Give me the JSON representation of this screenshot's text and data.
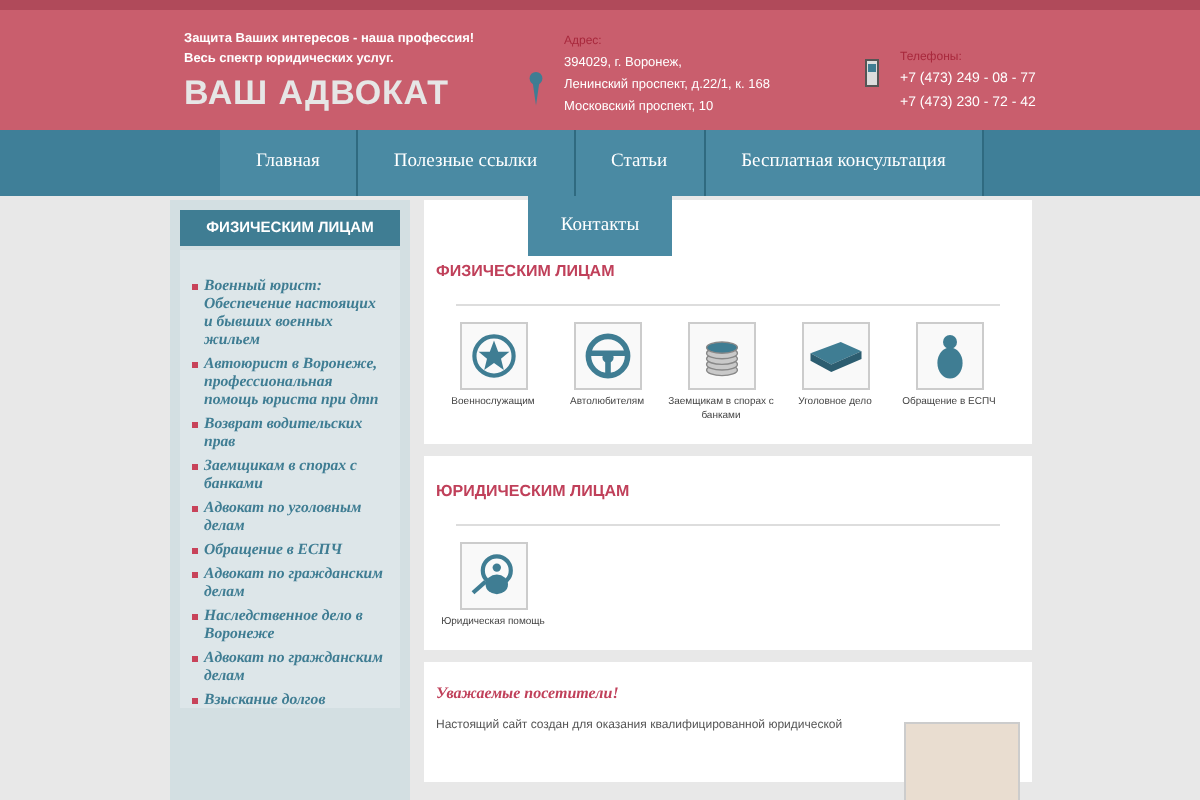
{
  "header": {
    "tagline": [
      "Защита Ваших интересов - наша профессия!",
      "Весь спектр юридических услуг."
    ],
    "logo": "ВАШ АДВОКАТ",
    "address_label": "Адрес:",
    "address_lines": [
      "394029, г. Воронеж,",
      "Ленинский проспект, д.22/1, к. 168",
      "Московский проспект, 10"
    ],
    "phone_label": "Телефоны:",
    "phones": [
      "+7 (473) 249 - 08 - 77",
      "+7 (473) 230 - 72 - 42"
    ]
  },
  "nav": [
    {
      "label": "Главная"
    },
    {
      "label": "Полезные ссылки"
    },
    {
      "label": "Статьи"
    },
    {
      "label": "Бесплатная консультация"
    },
    {
      "label": "Контакты"
    }
  ],
  "sidebar": {
    "title": "ФИЗИЧЕСКИМ ЛИЦАМ",
    "items": [
      "Военный юрист: Обеспечение настоящих и бывших военных жильем",
      "Автоюрист в Воронеже, профессиональная помощь юриста при дтп",
      "Возврат водительских прав",
      "Заемщикам в спорах с банками",
      "Адвокат по уголовным делам",
      "Обращение в ЕСПЧ",
      "Адвокат по гражданским делам",
      "Наследственное дело в Воронеже",
      "Адвокат по гражданским делам",
      "Взыскание долгов"
    ]
  },
  "sections": [
    {
      "title": "ФИЗИЧЕСКИМ ЛИЦАМ",
      "tiles": [
        {
          "kind": "star",
          "label": "Военнослужащим"
        },
        {
          "kind": "wheel",
          "label": "Автолюбителям"
        },
        {
          "kind": "coins",
          "label": "Заемщикам в спорах с банками"
        },
        {
          "kind": "book",
          "label": "Уголовное дело"
        },
        {
          "kind": "person",
          "label": "Обращение в ЕСПЧ"
        }
      ]
    },
    {
      "title": "ЮРИДИЧЕСКИМ ЛИЦАМ",
      "tiles": [
        {
          "kind": "magnifier",
          "label": "Юридическая помощь"
        }
      ]
    }
  ],
  "welcome": {
    "title": "Уважаемые посетители!",
    "text": "Настоящий сайт создан для оказания квалифицированной юридической"
  }
}
